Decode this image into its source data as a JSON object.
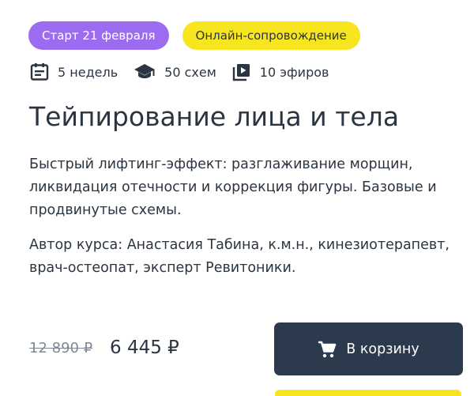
{
  "badges": {
    "start": "Старт 21 февраля",
    "format": "Онлайн-сопровождение"
  },
  "meta": {
    "weeks": "5 недель",
    "schemes": "50 схем",
    "streams": "10 эфиров",
    "icons": [
      "calendar-icon",
      "graduation-cap-icon",
      "video-library-icon"
    ]
  },
  "course": {
    "title": "Тейпирование лица и тела",
    "description": "Быстрый лифтинг-эффект: разглаживание морщин, ликвидация отечности и коррекция фигуры. Базовые и продвинутые схемы.",
    "author": "Автор курса: Анастасия Табина, к.м.н., кинезиотерапевт, врач-остеопат, эксперт Ревитоники."
  },
  "price": {
    "old": "12 890 ₽",
    "new": "6 445 ₽"
  },
  "cart": {
    "label": "В корзину",
    "icon": "cart-icon"
  },
  "colors": {
    "start_badge": "#9b6cf0",
    "format_badge": "#f7e51f",
    "button": "#2b3a4c",
    "text": "#2b3541",
    "old_price": "#7d8894"
  }
}
